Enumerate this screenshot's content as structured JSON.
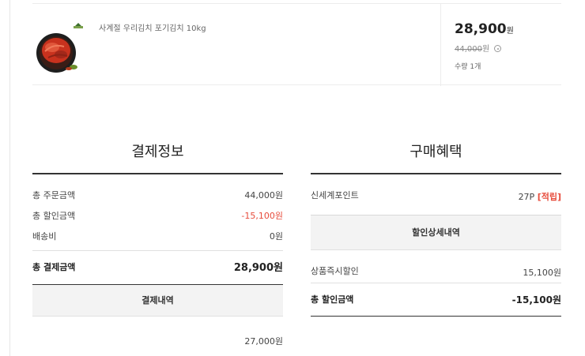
{
  "product": {
    "name": "사계절 우리김치 포기김치 10kg",
    "price": "28,900",
    "price_unit": "원",
    "original_price": "44,000",
    "original_unit": "원",
    "quantity": "수량 1개",
    "image_icon": "kimchi-product-image"
  },
  "payment_info": {
    "title": "결제정보",
    "rows": [
      {
        "label": "총 주문금액",
        "value": "44,000원"
      },
      {
        "label": "총 할인금액",
        "value": "-15,100원"
      },
      {
        "label": "배송비",
        "value": "0원"
      }
    ],
    "total_label": "총 결제금액",
    "total_value": "28,900원",
    "detail_header": "결제내역",
    "detail_value": "27,000원"
  },
  "benefits": {
    "title": "구매혜택",
    "point_label": "신세계포인트",
    "point_value": "27P",
    "point_tag": "[적립]",
    "discount_header": "할인상세내역",
    "discount_label": "상품즉시할인",
    "discount_value": "15,100원",
    "total_label": "총 할인금액",
    "total_value": "-15,100원"
  },
  "colors": {
    "accent_red": "#e74c3c",
    "text_dark": "#222222",
    "bar_gray": "#f3f3f3"
  }
}
